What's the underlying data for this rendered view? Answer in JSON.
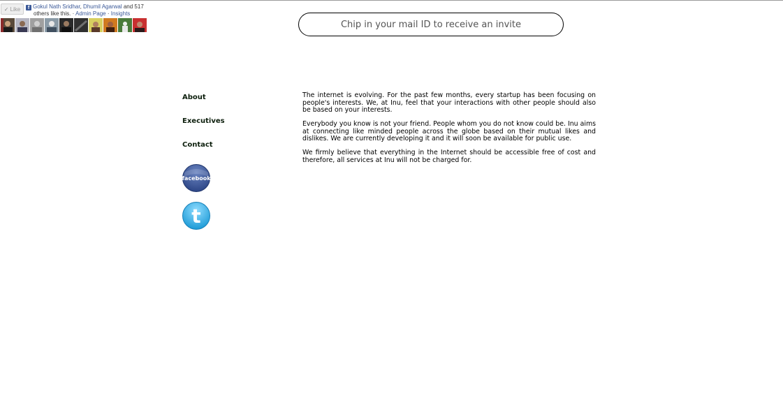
{
  "facebook_widget": {
    "like_label": "Like",
    "friend_1": "Gokul Nath Sridhar",
    "separator_1": ", ",
    "friend_2": "Dhumil Agarwal",
    "and_count": " and 517",
    "others_text": "others like this.",
    "dash": " · ",
    "admin_page": "Admin Page",
    "insights": "Insights",
    "faces": [
      "friend-avatar-1",
      "friend-avatar-2",
      "friend-avatar-3",
      "friend-avatar-4",
      "friend-avatar-5",
      "friend-avatar-6",
      "friend-avatar-7",
      "friend-avatar-8",
      "friend-avatar-9",
      "friend-avatar-10"
    ]
  },
  "invite": {
    "placeholder": "Chip in your mail ID to receive an invite"
  },
  "nav": {
    "about": "About",
    "executives": "Executives",
    "contact": "Contact"
  },
  "social": {
    "facebook_label": "facebook",
    "twitter_letter": "t"
  },
  "content": {
    "paragraphs": [
      "The internet is evolving. For the past few months, every startup has been focusing on people's interests. We, at Inu, feel that your interactions with other people should also be based on your interests.",
      "Everybody you know is not your friend. People whom you do not know could be. Inu aims at connecting like minded people across the globe based on their mutual likes and dislikes. We are currently developing it and it will soon be available for public use.",
      "We firmly believe that everything in the Internet should be accessible free of cost and therefore, all services at Inu will not be charged for."
    ]
  },
  "colors": {
    "facebook_blue": "#3b5998",
    "twitter_blue": "#3fb3e8",
    "nav_text": "#0d1f0d"
  }
}
